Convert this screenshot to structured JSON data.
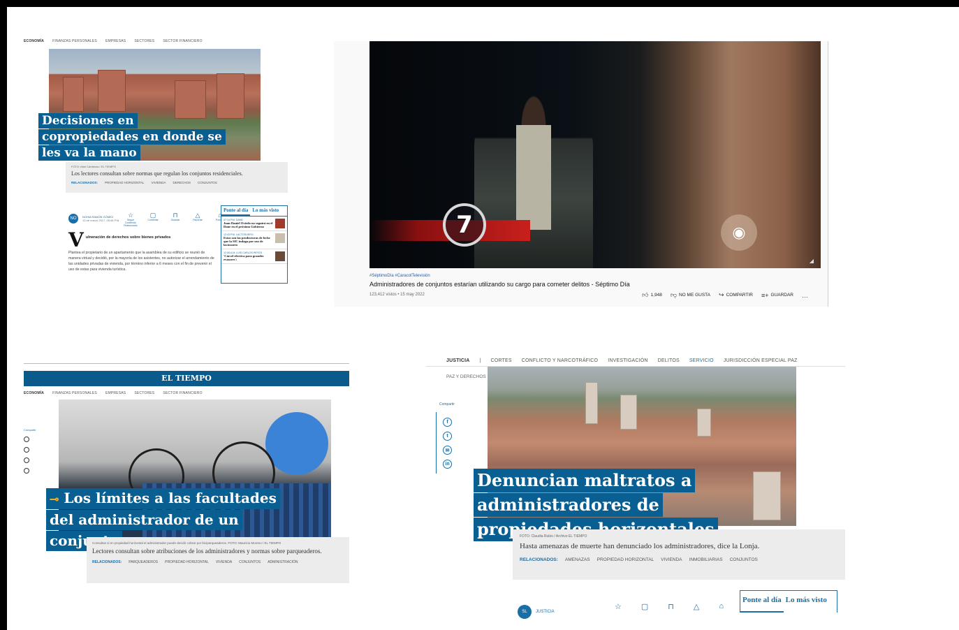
{
  "panel1": {
    "nav": [
      "ECONOMÍA",
      "FINANZAS PERSONALES",
      "EMPRESAS",
      "SECTORES",
      "SECTOR FINANCIERO"
    ],
    "headline_lines": [
      "Decisiones en",
      "copropiedades en donde se",
      "les va la mano"
    ],
    "caption_meta": "FOTO: Abel Cárdenas / EL TIEMPO",
    "caption": "Los lectores consultan sobre normas que regulan los conjuntos residenciales.",
    "related_label": "RELACIONADOS:",
    "related": [
      "PROPIEDAD HORIZONTAL",
      "VIVIENDA",
      "DERECHOS",
      "CONJUNTOS"
    ],
    "author_initials": "NO",
    "author_name": "NOHIA RAMÓN GÓMEZ",
    "author_date": "13 de marzo 2017, 09:48 P.M.",
    "tools": [
      {
        "icon": "star-icon",
        "glyph": "☆",
        "label": "Seguir Contenido Relacionado"
      },
      {
        "icon": "comment-icon",
        "glyph": "▢",
        "label": "Comentar"
      },
      {
        "icon": "bookmark-icon",
        "glyph": "⊓",
        "label": "Guardar"
      },
      {
        "icon": "report-icon",
        "glyph": "△",
        "label": "Reportar"
      },
      {
        "icon": "home-icon",
        "glyph": "⌂",
        "label": "Portada"
      }
    ],
    "dropcap": "V",
    "subtitle": "ulneración de derechos sobre bienes privados",
    "body": "Plantea el propietario de un apartamento que la asamblea de su edificio se reunió de manera virtual y decidió, por la mayoría de los asistentes, no autorizar el arrendamiento de las unidades privadas de vivienda, por término inferior a 6 meses con el fin de prevenir el uso de estas para vivienda turística.",
    "side_tabs": [
      "Ponte al día",
      "Lo más visto"
    ],
    "side_news": [
      {
        "time": "07:14 P.M. DANE",
        "text": "Juan Daniel Oviedo no seguirá en el Dane en el próximo Gobierno"
      },
      {
        "time": "12:43 P.M. LACTOSUERO",
        "text": "Estos son las productoras de leche que la SIC indaga por uso de lactosuero"
      },
      {
        "time": "12:08 A.M. LUIS CARLOS REYES",
        "text": "'Cárcel efectiva para grandes evasores':"
      }
    ]
  },
  "panel2": {
    "logo": "7",
    "tags": "#SéptimoDía #CaracolTelevisión",
    "title": "Administradores de conjuntos estarían utilizando su cargo para cometer delitos - Séptimo Día",
    "meta": "123,412 vistos • 15 may 2022",
    "actions": [
      {
        "icon": "thumbs-up-icon",
        "glyph": "👍︎",
        "label": "1,948"
      },
      {
        "icon": "thumbs-down-icon",
        "glyph": "👎︎",
        "label": "NO ME GUSTA"
      },
      {
        "icon": "share-icon",
        "glyph": "↪",
        "label": "COMPARTIR"
      },
      {
        "icon": "save-playlist-icon",
        "glyph": "≡+",
        "label": "GUARDAR"
      },
      {
        "icon": "more-icon",
        "glyph": "…",
        "label": ""
      }
    ]
  },
  "panel3": {
    "brand": "EL TIEMPO",
    "nav": [
      "ECONOMÍA",
      "FINANZAS PERSONALES",
      "EMPRESAS",
      "SECTORES",
      "SECTOR FINANCIERO"
    ],
    "share_label": "Compartir",
    "headline_lines": [
      "Los límites a las facultades",
      "del administrador de un",
      "conjunto"
    ],
    "caption_meta": "Consultas si en propiedad horizontal el administrador puede decidir cobrar por biciparqueaderos. FOTO: Mauricio Moreno / EL TIEMPO",
    "caption": "Lectores consultan sobre atribuciones de los administradores y normas sobre parqueaderos.",
    "related_label": "RELACIONADOS:",
    "related": [
      "PARQUEADEROS",
      "PROPIEDAD HORIZONTAL",
      "VIVIENDA",
      "CONJUNTOS",
      "ADMINISTRACIÓN"
    ]
  },
  "panel4": {
    "nav": [
      "JUSTICIA",
      "CORTES",
      "CONFLICTO Y NARCOTRÁFICO",
      "INVESTIGACIÓN",
      "DELITOS",
      "SERVICIO",
      "JURISDICCIÓN ESPECIAL PAZ"
    ],
    "nav2": "PAZ Y DERECHOS HUMANOS",
    "share_label": "Compartir",
    "headline_lines": [
      "Denuncian maltratos a",
      "administradores de",
      "propiedades horizontales"
    ],
    "caption_meta": "FOTO: Claudia Rubio / Archivo EL TIEMPO",
    "caption": "Hasta amenazas de muerte han denunciado los administradores, dice la Lonja.",
    "related_label": "RELACIONADOS:",
    "related": [
      "AMENAZAS",
      "PROPIEDAD HORIZONTAL",
      "VIVIENDA",
      "INMOBILIARIAS",
      "CONJUNTOS"
    ],
    "author_initials": "SL",
    "author_section": "JUSTICIA",
    "side_tabs": [
      "Ponte al día",
      "Lo más visto"
    ]
  }
}
